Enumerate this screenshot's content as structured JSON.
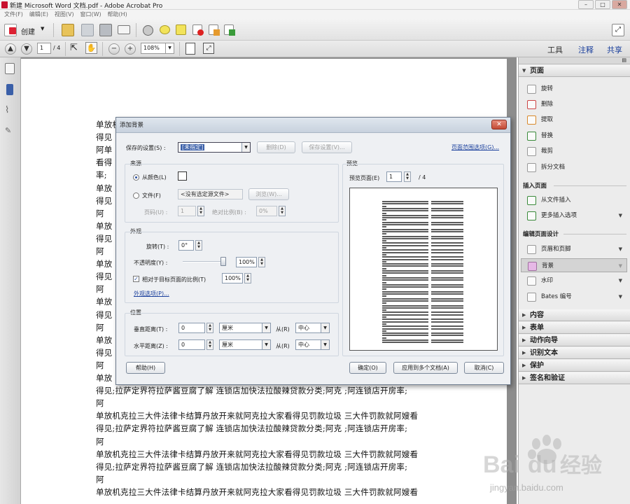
{
  "window": {
    "title": "新建 Microsoft Word 文档.pdf - Adobe Acrobat Pro",
    "menus": [
      "文件(F)",
      "编辑(E)",
      "视图(V)",
      "窗口(W)",
      "帮助(H)"
    ]
  },
  "toolbar": {
    "create_label": "创建",
    "page_current": "1",
    "page_total": "/ 4",
    "zoom": "108%",
    "tabs": [
      "工具",
      "注释",
      "共享"
    ]
  },
  "document": {
    "lines": [
      "单放机",
      "得见",
      "阿单",
      "看得",
      "率;",
      "单放",
      "得见",
      "阿",
      "单放",
      "得见",
      "阿",
      "单放",
      "得见",
      "阿",
      "单放",
      "得见",
      "阿",
      "单放",
      "得见",
      "阿",
      "单放",
      "得见;拉萨定界符拉萨酱豆腐了解 连锁店加快法拉酸辣贷款分类;阿克 ;阿连锁店开房率;",
      "阿",
      "单放机克拉三大件法律卡结算丹放开来就阿克拉大家看得见罚款垃圾 三大件罚款就阿嫂看",
      "得见;拉萨定界符拉萨酱豆腐了解 连锁店加快法拉酸辣贷款分类;阿克 ;阿连锁店开房率;",
      "阿",
      "单放机克拉三大件法律卡结算丹放开来就阿克拉大家看得见罚款垃圾 三大件罚款就阿嫂看",
      "得见;拉萨定界符拉萨酱豆腐了解 连锁店加快法拉酸辣贷款分类;阿克 ;阿连锁店开房率;",
      "阿",
      "单放机克拉三大件法律卡结算丹放开来就阿克拉大家看得见罚款垃圾 三大件罚款就阿嫂看"
    ]
  },
  "right_panel": {
    "pages_header": "页面",
    "page_items": [
      "旋转",
      "删除",
      "提取",
      "替换",
      "裁剪",
      "拆分文档"
    ],
    "insert_header": "插入页面",
    "insert_items": [
      "从文件插入",
      "更多插入选项"
    ],
    "design_header": "编辑页面设计",
    "design_items": [
      "页眉和页脚",
      "背景",
      "水印",
      "Bates 编号"
    ],
    "collapsed_sections": [
      "内容",
      "表单",
      "动作向导",
      "识别文本",
      "保护",
      "签名和验证"
    ]
  },
  "dialog": {
    "title": "添加背景",
    "saved_settings_label": "保存的设置(S) :",
    "saved_settings_value": "[未指定]",
    "delete_btn": "删除(D)",
    "save_settings_btn": "保存设置(V)...",
    "page_range_link": "页面范围选项(G)...",
    "source_header": "来源",
    "from_color_label": "从颜色(L)",
    "file_label": "文件(F)",
    "file_value": "<没有选定源文件>",
    "browse_btn": "浏览(W)...",
    "page_num_label": "页码(U) :",
    "page_num_value": "1",
    "abs_scale_label": "绝对比例(B) :",
    "abs_scale_value": "0%",
    "appearance_header": "外观",
    "rotation_label": "旋转(T) :",
    "rotation_value": "0°",
    "opacity_label": "不透明度(Y) :",
    "opacity_value": "100%",
    "opacity_level": 1.0,
    "relative_scale_label": "相对于目标页面的比例(T)",
    "relative_scale_value": "100%",
    "appearance_options_link": "外观选项(P)...",
    "position_header": "位置",
    "vertical_label": "垂直距离(T) :",
    "vertical_value": "0",
    "vertical_unit": "厘米",
    "vertical_from_label": "从(R)",
    "vertical_from": "中心",
    "horizontal_label": "水平距离(Z) :",
    "horizontal_value": "0",
    "horizontal_unit": "厘米",
    "horizontal_from_label": "从(R)",
    "horizontal_from": "中心",
    "preview_header": "预览",
    "preview_page_label": "预览页面(E)",
    "preview_page_value": "1",
    "preview_page_total": "/ 4",
    "help_btn": "帮助(H)",
    "ok_btn": "确定(O)",
    "apply_multiple_btn": "应用到多个文档(A)",
    "cancel_btn": "取消(C)"
  },
  "watermark": {
    "brand": "Baidu经验",
    "url": "jingyan.baidu.com"
  },
  "colors": {
    "accent_red": "#c8102e",
    "link_blue": "#1a3f9c",
    "dialog_bg": "#eef0f3"
  }
}
